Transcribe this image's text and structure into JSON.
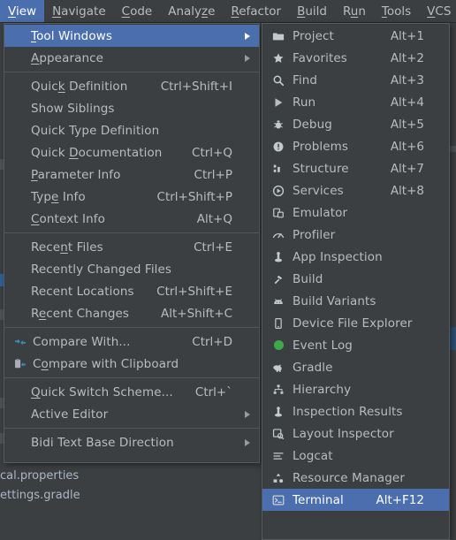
{
  "menubar": {
    "items": [
      {
        "label": "View",
        "mnemonic": "V",
        "active": true
      },
      {
        "label": "Navigate",
        "mnemonic": "N",
        "active": false
      },
      {
        "label": "Code",
        "mnemonic": "C",
        "active": false
      },
      {
        "label": "Analyze",
        "mnemonic": "z",
        "active": false
      },
      {
        "label": "Refactor",
        "mnemonic": "R",
        "active": false
      },
      {
        "label": "Build",
        "mnemonic": "B",
        "active": false
      },
      {
        "label": "Run",
        "mnemonic": "u",
        "active": false
      },
      {
        "label": "Tools",
        "mnemonic": "T",
        "active": false
      },
      {
        "label": "VCS",
        "mnemonic": "V",
        "active": false
      }
    ]
  },
  "view_menu": {
    "title": "View",
    "items": [
      {
        "label": "Tool Windows",
        "shortcut": "",
        "submenu": true,
        "selected": true,
        "icon": "",
        "mnemonic": "T"
      },
      {
        "label": "Appearance",
        "shortcut": "",
        "submenu": true,
        "selected": false,
        "icon": "",
        "mnemonic": "A"
      },
      {
        "separator": true
      },
      {
        "label": "Quick Definition",
        "shortcut": "Ctrl+Shift+I",
        "submenu": false,
        "selected": false,
        "icon": "",
        "mnemonic": "k"
      },
      {
        "label": "Show Siblings",
        "shortcut": "",
        "submenu": false,
        "selected": false,
        "icon": ""
      },
      {
        "label": "Quick Type Definition",
        "shortcut": "",
        "submenu": false,
        "selected": false,
        "icon": ""
      },
      {
        "label": "Quick Documentation",
        "shortcut": "Ctrl+Q",
        "submenu": false,
        "selected": false,
        "icon": "",
        "mnemonic": "D"
      },
      {
        "label": "Parameter Info",
        "shortcut": "Ctrl+P",
        "submenu": false,
        "selected": false,
        "icon": "",
        "mnemonic": "P"
      },
      {
        "label": "Type Info",
        "shortcut": "Ctrl+Shift+P",
        "submenu": false,
        "selected": false,
        "icon": "",
        "mnemonic": "e"
      },
      {
        "label": "Context Info",
        "shortcut": "Alt+Q",
        "submenu": false,
        "selected": false,
        "icon": "",
        "mnemonic": "C"
      },
      {
        "separator": true
      },
      {
        "label": "Recent Files",
        "shortcut": "Ctrl+E",
        "submenu": false,
        "selected": false,
        "icon": "",
        "mnemonic": "n"
      },
      {
        "label": "Recently Changed Files",
        "shortcut": "",
        "submenu": false,
        "selected": false,
        "icon": ""
      },
      {
        "label": "Recent Locations",
        "shortcut": "Ctrl+Shift+E",
        "submenu": false,
        "selected": false,
        "icon": ""
      },
      {
        "label": "Recent Changes",
        "shortcut": "Alt+Shift+C",
        "submenu": false,
        "selected": false,
        "icon": "",
        "mnemonic": "e"
      },
      {
        "separator": true
      },
      {
        "label": "Compare With...",
        "shortcut": "Ctrl+D",
        "submenu": false,
        "selected": false,
        "icon": "compare-icon"
      },
      {
        "label": "Compare with Clipboard",
        "shortcut": "",
        "submenu": false,
        "selected": false,
        "icon": "compare-clipboard-icon",
        "mnemonic": "o"
      },
      {
        "separator": true
      },
      {
        "label": "Quick Switch Scheme...",
        "shortcut": "Ctrl+`",
        "submenu": false,
        "selected": false,
        "icon": "",
        "mnemonic": "Q"
      },
      {
        "label": "Active Editor",
        "shortcut": "",
        "submenu": true,
        "selected": false,
        "icon": ""
      },
      {
        "separator": true
      },
      {
        "label": "Bidi Text Base Direction",
        "shortcut": "",
        "submenu": true,
        "selected": false,
        "icon": ""
      }
    ]
  },
  "tool_windows_menu": {
    "title": "Tool Windows",
    "items": [
      {
        "label": "Project",
        "shortcut": "Alt+1",
        "icon": "folder-icon",
        "selected": false
      },
      {
        "label": "Favorites",
        "shortcut": "Alt+2",
        "icon": "star-icon",
        "selected": false
      },
      {
        "label": "Find",
        "shortcut": "Alt+3",
        "icon": "search-icon",
        "selected": false
      },
      {
        "label": "Run",
        "shortcut": "Alt+4",
        "icon": "play-icon",
        "selected": false
      },
      {
        "label": "Debug",
        "shortcut": "Alt+5",
        "icon": "bug-icon",
        "selected": false
      },
      {
        "label": "Problems",
        "shortcut": "Alt+6",
        "icon": "problems-icon",
        "selected": false
      },
      {
        "label": "Structure",
        "shortcut": "Alt+7",
        "icon": "structure-icon",
        "selected": false
      },
      {
        "label": "Services",
        "shortcut": "Alt+8",
        "icon": "services-icon",
        "selected": false
      },
      {
        "label": "Emulator",
        "shortcut": "",
        "icon": "emulator-icon",
        "selected": false
      },
      {
        "label": "Profiler",
        "shortcut": "",
        "icon": "profiler-icon",
        "selected": false
      },
      {
        "label": "App Inspection",
        "shortcut": "",
        "icon": "app-inspection-icon",
        "selected": false
      },
      {
        "label": "Build",
        "shortcut": "",
        "icon": "hammer-icon",
        "selected": false
      },
      {
        "label": "Build Variants",
        "shortcut": "",
        "icon": "android-icon",
        "selected": false
      },
      {
        "label": "Device File Explorer",
        "shortcut": "",
        "icon": "device-icon",
        "selected": false
      },
      {
        "label": "Event Log",
        "shortcut": "",
        "icon": "event-log-icon",
        "selected": false
      },
      {
        "label": "Gradle",
        "shortcut": "",
        "icon": "gradle-elephant-icon",
        "selected": false
      },
      {
        "label": "Hierarchy",
        "shortcut": "",
        "icon": "hierarchy-icon",
        "selected": false
      },
      {
        "label": "Inspection Results",
        "shortcut": "",
        "icon": "inspection-results-icon",
        "selected": false
      },
      {
        "label": "Layout Inspector",
        "shortcut": "",
        "icon": "layout-inspector-icon",
        "selected": false
      },
      {
        "label": "Logcat",
        "shortcut": "",
        "icon": "logcat-icon",
        "selected": false
      },
      {
        "label": "Resource Manager",
        "shortcut": "",
        "icon": "resource-manager-icon",
        "selected": false
      },
      {
        "label": "Terminal",
        "shortcut": "Alt+F12",
        "icon": "terminal-icon",
        "selected": true
      }
    ]
  },
  "background": {
    "files": [
      "cal.properties",
      "ettings.gradle"
    ]
  },
  "colors": {
    "menu_bg": "#3c3f41",
    "menu_border": "#565a5c",
    "selection": "#4b6eaf",
    "text": "#bbbbbb",
    "text_selected": "#ffffff",
    "separator": "#515658",
    "accent_blue": "#3592c4",
    "event_log_green": "#3ea948",
    "file_text": "#a9b7c6"
  }
}
